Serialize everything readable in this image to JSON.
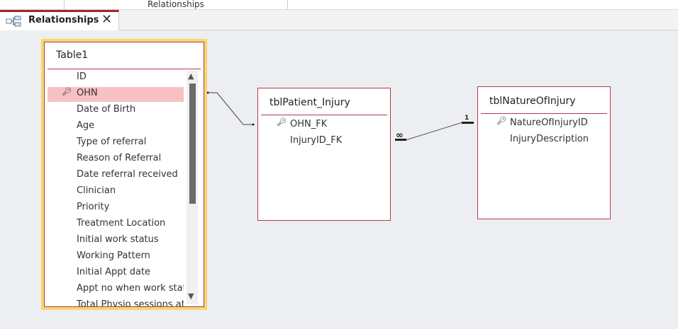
{
  "top_ribbon": {
    "label": "Relationships"
  },
  "tab": {
    "label": "Relationships",
    "icon": "relationships-icon",
    "close": "✕"
  },
  "colors": {
    "accent": "#a4262c",
    "table_border": "#b23a48",
    "selected_border": "#f5d76e",
    "selected_row": "#f7c1c3",
    "canvas": "#eceef1"
  },
  "tables": [
    {
      "title": "Table1",
      "selected": true,
      "fields": [
        "ID",
        "OHN",
        "Date of Birth",
        "Age",
        "Type of referral",
        "Reason of Referral",
        "Date referral received",
        "Clinician",
        "Priority",
        "Treatment Location",
        "Initial work status",
        "Working Pattern",
        "Initial Appt date",
        "Appt no when work status",
        "Total Physio sessions att"
      ],
      "key_field": "OHN"
    },
    {
      "title": "tblPatient_Injury",
      "fields": [
        "OHN_FK",
        "InjuryID_FK"
      ],
      "key_field": "OHN_FK"
    },
    {
      "title": "tblNatureOfInjury",
      "fields": [
        "NatureOfInjuryID",
        "InjuryDescription"
      ],
      "key_field": "NatureOfInjuryID"
    }
  ],
  "relationships": [
    {
      "from": "Table1.OHN",
      "to": "tblPatient_Injury.OHN_FK"
    },
    {
      "from": "tblNatureOfInjury.NatureOfInjuryID",
      "to": "tblPatient_Injury.InjuryID_FK",
      "one_label": "1",
      "many_label": "∞"
    }
  ]
}
